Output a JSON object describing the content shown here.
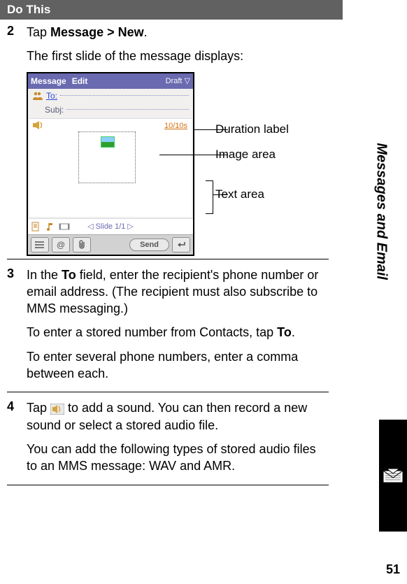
{
  "header": "Do This",
  "steps": {
    "s2": {
      "num": "2",
      "line1_pre": "Tap ",
      "line1_bold": "Message > New",
      "line1_post": ".",
      "line2": "The first slide of the message displays:"
    },
    "s3": {
      "num": "3",
      "p1_pre": "In the ",
      "p1_bold": "To",
      "p1_post": " field, enter the recipient's phone number or email address. (The recipient must also subscribe to MMS messaging.)",
      "p2_pre": "To enter a stored number from Contacts, tap ",
      "p2_bold": "To",
      "p2_post": ".",
      "p3": "To enter several phone numbers, enter a comma between each."
    },
    "s4": {
      "num": "4",
      "p1_pre": "Tap ",
      "p1_post": " to add a sound. You can then record a new sound or select a stored audio file.",
      "p2": "You can add the following types of stored audio files to an MMS message: WAV and AMR."
    }
  },
  "mock": {
    "title_message": "Message",
    "title_edit": "Edit",
    "draft": "Draft ▽",
    "to": "To:",
    "subj": "Subj:",
    "duration": "10/10s",
    "slide": "Slide 1/1",
    "send": "Send",
    "at": "@"
  },
  "callouts": {
    "duration": "Duration label",
    "image": "Image area",
    "text": "Text area"
  },
  "side": "Messages and Email",
  "page": "51"
}
